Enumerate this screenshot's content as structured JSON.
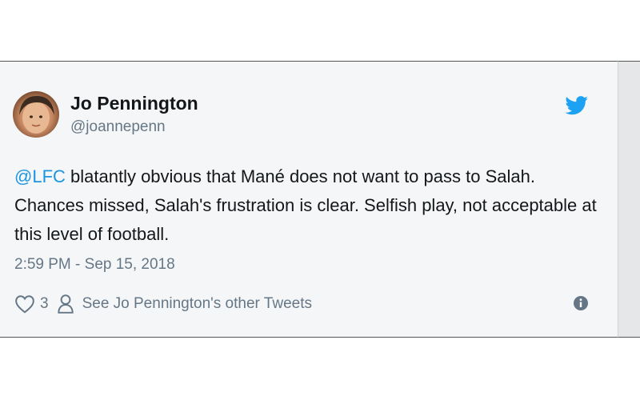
{
  "tweet": {
    "author_name": "Jo Pennington",
    "handle": "@joannepenn",
    "mention": "@LFC",
    "body": " blatantly obvious that Mané does not want to pass to Salah. Chances missed, Salah's frustration is clear. Selfish play, not acceptable at this level of football.",
    "timestamp": "2:59 PM - Sep 15, 2018",
    "like_count": "3",
    "other_tweets_link": "See Jo Pennington's other Tweets"
  },
  "icons": {
    "brand": "twitter-bird-icon",
    "like": "heart-icon",
    "profile": "person-icon",
    "info": "info-icon"
  },
  "colors": {
    "link_blue": "#1b95e0",
    "text_dark": "#14171a",
    "text_muted": "#657786",
    "card_background": "#f5f6f7"
  }
}
